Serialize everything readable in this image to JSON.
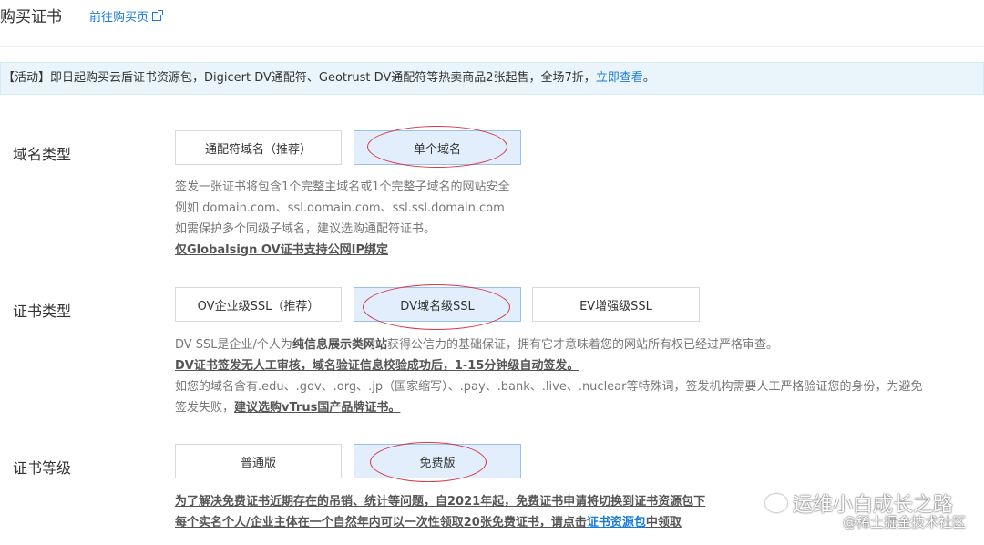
{
  "header": {
    "title": "购买证书",
    "link": "前往购买页"
  },
  "banner": {
    "text": "【活动】即日起购买云盾证书资源包，Digicert DV通配符、Geotrust DV通配符等热卖商品2张起售，全场7折，",
    "link": "立即查看",
    "suffix": "。"
  },
  "domain_type": {
    "label": "域名类型",
    "options": [
      "通配符域名（推荐）",
      "单个域名"
    ],
    "selected": "单个域名",
    "desc": [
      "签发一张证书将包含1个完整主域名或1个完整子域名的网站安全",
      "例如 domain.com、ssl.domain.com、ssl.ssl.domain.com",
      "如需保护多个同级子域名，建议选购通配符证书。",
      "仅Globalsign OV证书支持公网IP绑定"
    ]
  },
  "cert_type": {
    "label": "证书类型",
    "options": [
      "OV企业级SSL（推荐）",
      "DV域名级SSL",
      "EV增强级SSL"
    ],
    "selected": "DV域名级SSL",
    "desc_line1_a": "DV SSL是企业/个人为",
    "desc_line1_b": "纯信息展示类网站",
    "desc_line1_c": "获得公信力的基础保证，拥有它才意味着您的网站所有权已经过严格审查。",
    "desc_line2": "DV证书签发无人工审核，域名验证信息校验成功后，1-15分钟级自动签发。",
    "desc_line3": "如您的域名含有.edu、.gov、.org、.jp（国家缩写）、.pay、.bank、.live、.nuclear等特殊词，签发机构需要人工严格验证您的身份，为避免",
    "desc_line4_a": "签发失败，",
    "desc_line4_b": "建议选购vTrus国产品牌证书。"
  },
  "cert_level": {
    "label": "证书等级",
    "options": [
      "普通版",
      "免费版"
    ],
    "selected": "免费版",
    "note_line1": "为了解决免费证书近期存在的吊销、统计等问题，自2021年起，免费证书申请将切换到证书资源包下",
    "note_line2_a": "每个实名个人/企业主体在一个自然年内可以一次性领取20张免费证书，请点击",
    "note_line2_link": "证书资源包",
    "note_line2_b": "中领取"
  },
  "watermark": {
    "main": "运维小白成长之路",
    "sub": "@稀土掘金技术社区"
  }
}
